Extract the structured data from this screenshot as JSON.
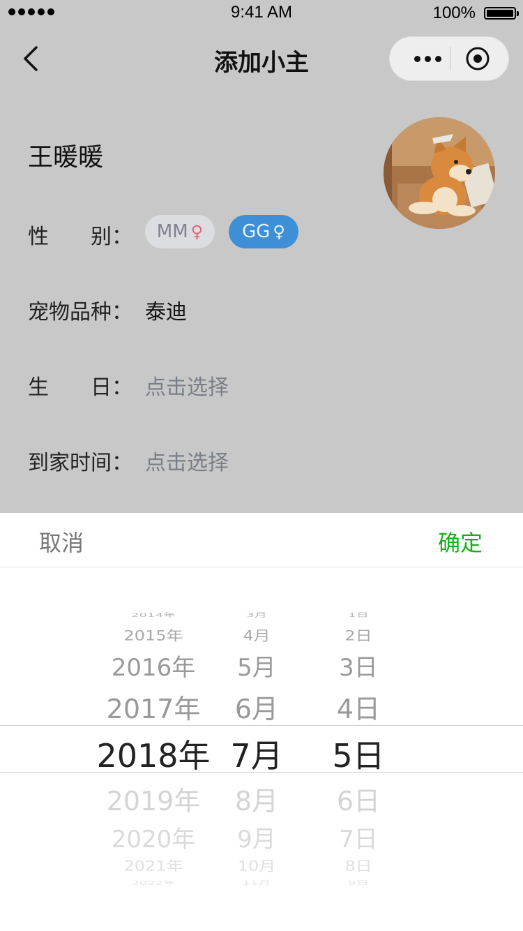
{
  "status_bar": {
    "time": "9:41 AM",
    "battery": "100%"
  },
  "nav": {
    "title": "添加小主"
  },
  "profile": {
    "name": "王暖暖",
    "gender": {
      "label_a": "性",
      "label_b": "别",
      "colon": "：",
      "option_female": "MM",
      "option_male": "GG",
      "female_symbol": "♀",
      "male_symbol": "♀"
    },
    "breed": {
      "label": "宠物品种",
      "colon": "：",
      "value": "泰迪"
    },
    "birthday": {
      "label_a": "生",
      "label_b": "日",
      "colon": "：",
      "value": "点击选择"
    },
    "home_date": {
      "label": "到家时间",
      "colon": "：",
      "value": "点击选择"
    }
  },
  "picker": {
    "cancel": "取消",
    "confirm": "确定",
    "years": [
      "2014年",
      "2015年",
      "2016年",
      "2017年",
      "2018年",
      "2019年",
      "2020年",
      "2021年",
      "2022年"
    ],
    "months": [
      "3月",
      "4月",
      "5月",
      "6月",
      "7月",
      "8月",
      "9月",
      "10月",
      "11月"
    ],
    "days": [
      "1日",
      "2日",
      "3日",
      "4日",
      "5日",
      "6日",
      "7日",
      "8日",
      "9日"
    ],
    "selected": {
      "year": "2018年",
      "month": "7月",
      "day": "5日"
    }
  },
  "colors": {
    "confirm": "#1aad19",
    "male_pill": "#3d8fd6",
    "overlay": "#c8c8c8"
  }
}
